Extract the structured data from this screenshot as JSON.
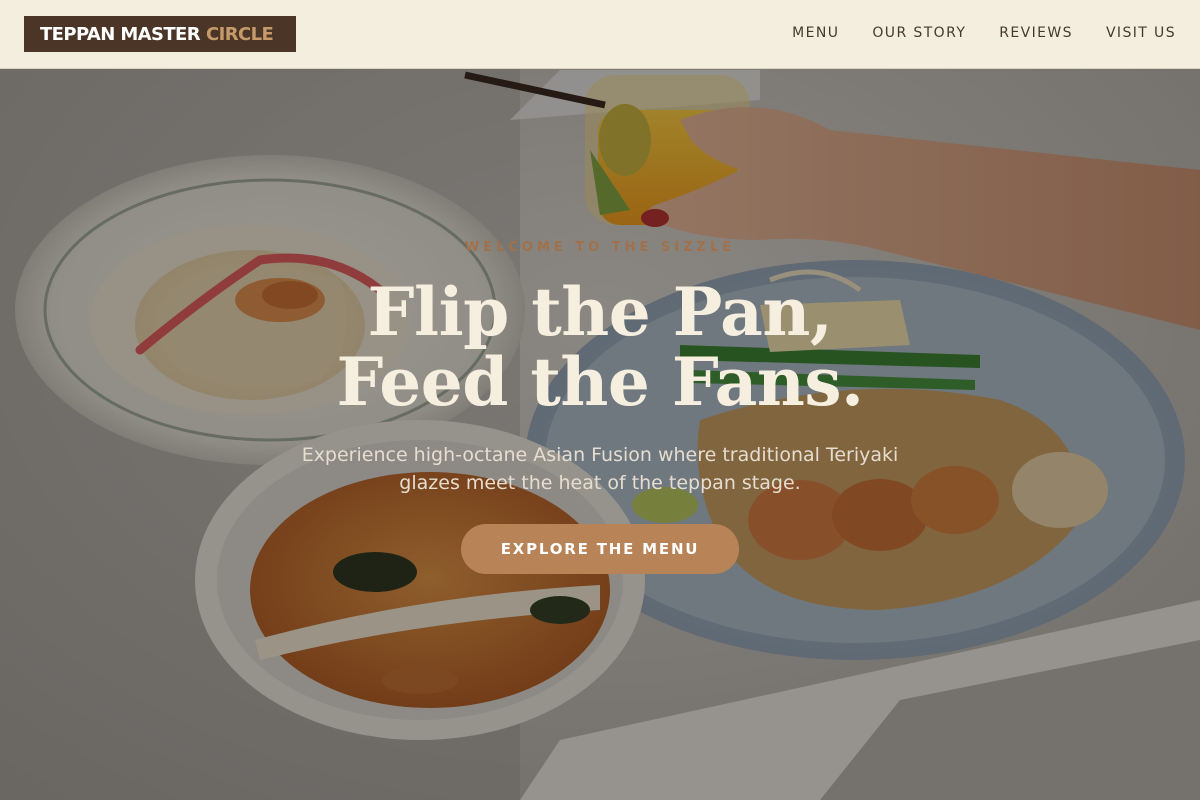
{
  "brand": {
    "name_part1": "TEPPAN MASTER",
    "name_part2": "CIRCLE"
  },
  "nav": {
    "items": [
      "MENU",
      "OUR STORY",
      "REVIEWS",
      "VISIT US"
    ]
  },
  "hero": {
    "eyebrow": "WELCOME TO THE SIZZLE",
    "headline_line1": "Flip the Pan,",
    "headline_line2": "Feed the Fans.",
    "subtitle": "Experience high-octane Asian Fusion where traditional Teriyaki glazes meet the heat of the teppan stage.",
    "cta_label": "EXPLORE THE MENU"
  },
  "colors": {
    "header_bg": "#f3eedd",
    "logo_bg": "#4a3526",
    "logo_accent": "#c79a6a",
    "eyebrow": "#a0714a",
    "headline": "#f6efe0",
    "cta_bg": "#b98358"
  }
}
